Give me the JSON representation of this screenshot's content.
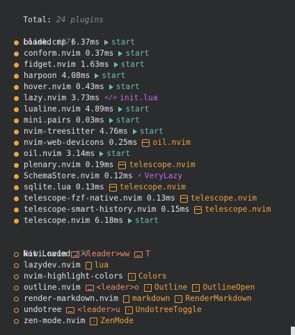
{
  "header": {
    "total_label": "Total:",
    "total_value": "24 plugins"
  },
  "loaded": {
    "title": "Loaded",
    "count": "(17)",
    "items": [
      {
        "name": "blink.cmp",
        "time": "6.37ms",
        "src_type": "start",
        "src": "start"
      },
      {
        "name": "conform.nvim",
        "time": "0.37ms",
        "src_type": "start",
        "src": "start"
      },
      {
        "name": "fidget.nvim",
        "time": "1.63ms",
        "src_type": "start",
        "src": "start"
      },
      {
        "name": "harpoon",
        "time": "4.08ms",
        "src_type": "start",
        "src": "start"
      },
      {
        "name": "hover.nvim",
        "time": "0.43ms",
        "src_type": "start",
        "src": "start"
      },
      {
        "name": "lazy.nvim",
        "time": "3.73ms",
        "src_type": "lua",
        "src": "init.lua"
      },
      {
        "name": "lualine.nvim",
        "time": "4.89ms",
        "src_type": "start",
        "src": "start"
      },
      {
        "name": "mini.pairs",
        "time": "0.03ms",
        "src_type": "start",
        "src": "start"
      },
      {
        "name": "nvim-treesitter",
        "time": "4.76ms",
        "src_type": "start",
        "src": "start"
      },
      {
        "name": "nvim-web-devicons",
        "time": "0.25ms",
        "src_type": "parent",
        "src": "oil.nvim"
      },
      {
        "name": "oil.nvim",
        "time": "3.14ms",
        "src_type": "start",
        "src": "start"
      },
      {
        "name": "plenary.nvim",
        "time": "0.19ms",
        "src_type": "parent",
        "src": "telescope.nvim"
      },
      {
        "name": "SchemaStore.nvim",
        "time": "0.12ms",
        "src_type": "event",
        "src": "VeryLazy"
      },
      {
        "name": "sqlite.lua",
        "time": "0.13ms",
        "src_type": "parent",
        "src": "telescope.nvim"
      },
      {
        "name": "telescope-fzf-native.nvim",
        "time": "0.13ms",
        "src_type": "parent",
        "src": "telescope.nvim"
      },
      {
        "name": "telescope-smart-history.nvim",
        "time": "0.15ms",
        "src_type": "parent",
        "src": "telescope.nvim"
      },
      {
        "name": "telescope.nvim",
        "time": "6.18ms",
        "src_type": "start",
        "src": "start"
      }
    ]
  },
  "not_loaded": {
    "title": "Not Loaded",
    "count": "(7)",
    "items": [
      {
        "name": "kiwi.nvim",
        "triggers": [
          {
            "type": "key",
            "text": "<leader>ww"
          },
          {
            "type": "key",
            "text": "T"
          }
        ]
      },
      {
        "name": "lazydev.nvim",
        "triggers": [
          {
            "type": "ft",
            "text": "lua"
          }
        ]
      },
      {
        "name": "nvim-highlight-colors",
        "triggers": [
          {
            "type": "cmd",
            "text": "Colors"
          }
        ]
      },
      {
        "name": "outline.nvim",
        "triggers": [
          {
            "type": "key",
            "text": "<leader>o"
          },
          {
            "type": "cmd",
            "text": "Outline"
          },
          {
            "type": "cmd",
            "text": "OutlineOpen"
          }
        ]
      },
      {
        "name": "render-markdown.nvim",
        "triggers": [
          {
            "type": "ft",
            "text": "markdown"
          },
          {
            "type": "cmd",
            "text": "RenderMarkdown"
          }
        ]
      },
      {
        "name": "undotree",
        "triggers": [
          {
            "type": "key",
            "text": "<leader>u"
          },
          {
            "type": "cmd",
            "text": "UndotreeToggle"
          }
        ]
      },
      {
        "name": "zen-mode.nvim",
        "triggers": [
          {
            "type": "cmd",
            "text": "ZenMode"
          }
        ]
      }
    ]
  },
  "colors": {
    "background": "#2a2c2e",
    "accent": "#f0a23a",
    "start": "#6bbfb3",
    "lua": "#c66bdd",
    "key": "#ef8a60"
  }
}
